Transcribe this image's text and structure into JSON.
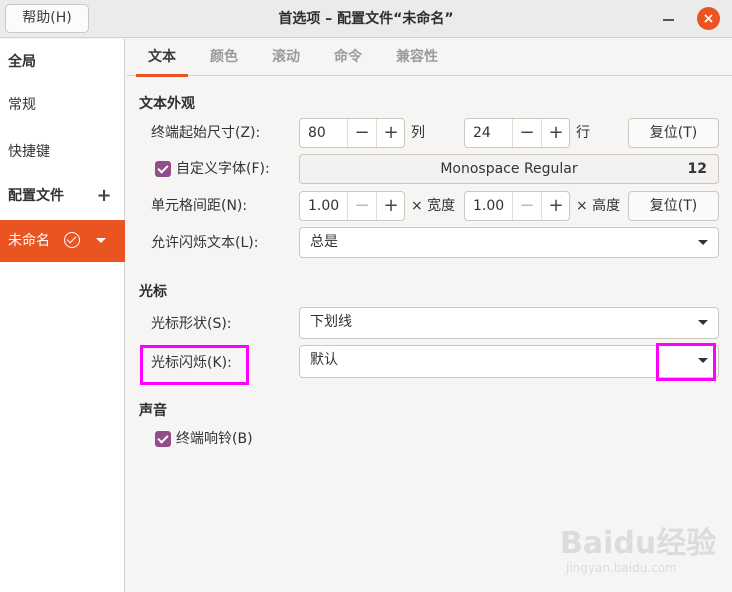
{
  "window": {
    "title": "首选项 – 配置文件“未命名”",
    "help_label": "帮助(H)"
  },
  "sidebar": {
    "global": "全局",
    "general": "常规",
    "shortcuts": "快捷键",
    "profiles": "配置文件",
    "add": "+",
    "selected_profile": "未命名"
  },
  "tabs": [
    "文本",
    "颜色",
    "滚动",
    "命令",
    "兼容性"
  ],
  "text_appearance": {
    "heading": "文本外观",
    "initial_size_label": "终端起始尺寸(Z):",
    "columns_value": "80",
    "columns_unit": "列",
    "rows_value": "24",
    "rows_unit": "行",
    "reset1": "复位(T)",
    "custom_font_label": "自定义字体(F):",
    "custom_font_checked": true,
    "font_name": "Monospace Regular",
    "font_size": "12",
    "cell_spacing_label": "单元格间距(N):",
    "width_value": "1.00",
    "width_unit": "× 宽度",
    "height_value": "1.00",
    "height_unit": "× 高度",
    "reset2": "复位(T)",
    "allow_blink_label": "允许闪烁文本(L):",
    "allow_blink_value": "总是"
  },
  "cursor": {
    "heading": "光标",
    "shape_label": "光标形状(S):",
    "shape_value": "下划线",
    "blink_label": "光标闪烁(K):",
    "blink_value": "默认"
  },
  "sound": {
    "heading": "声音",
    "bell_label": "终端响铃(B)",
    "bell_checked": true
  },
  "spin": {
    "minus": "−",
    "plus": "+"
  },
  "watermark": {
    "brand": "Baidu经验",
    "url": "jingyan.baidu.com"
  },
  "colors": {
    "accent": "#e95420",
    "check": "#924d8b",
    "highlight": "#ff00ff"
  }
}
